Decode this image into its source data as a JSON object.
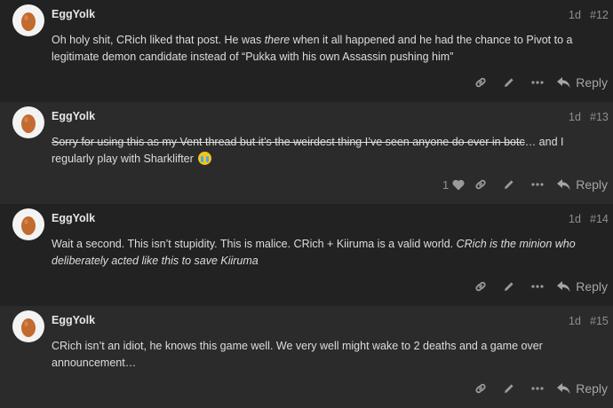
{
  "posts": [
    {
      "username": "EggYolk",
      "date": "1d",
      "number": "#12",
      "body_html": "Oh holy shit, CRich liked that post. He was <em>there</em> when it all happened and he had the chance to Pivot to a legitimate demon candidate instead of “Pukka with his own Assassin pushing him”",
      "likes": "",
      "reply_label": "Reply"
    },
    {
      "username": "EggYolk",
      "date": "1d",
      "number": "#13",
      "body_html": "<span class=\"strike\">Sorry for using this as my Vent thread but it’s the weirdest thing I’ve seen anyone do ever in botc</span>… and I regularly play with Sharklifter <span class=\"emoji\" data-name=\"crying-emoji-icon\" data-interactable=\"false\"></span>",
      "likes": "1",
      "reply_label": "Reply"
    },
    {
      "username": "EggYolk",
      "date": "1d",
      "number": "#14",
      "body_html": "Wait a second. This isn’t stupidity. This is malice. CRich + Kiiruma is a valid world. <em>CRich is the minion who deliberately acted like this to save Kiiruma</em>",
      "likes": "",
      "reply_label": "Reply"
    },
    {
      "username": "EggYolk",
      "date": "1d",
      "number": "#15",
      "body_html": "CRich isn’t an idiot, he knows this game well. We very well might wake to 2 deaths and a game over announcement…",
      "likes": "",
      "reply_label": "Reply"
    }
  ],
  "icons": {
    "avatar": "egg-avatar-icon",
    "like": "heart-icon",
    "link": "link-icon",
    "edit": "pencil-icon",
    "more": "ellipsis-icon",
    "reply": "reply-arrow-icon"
  },
  "colors": {
    "background": "#222222",
    "alt_background": "#2b2b2b",
    "text": "#dddddd",
    "muted": "#8f8f8f",
    "avatar_bg": "#f3f3f3",
    "egg": "#c26a2f"
  }
}
